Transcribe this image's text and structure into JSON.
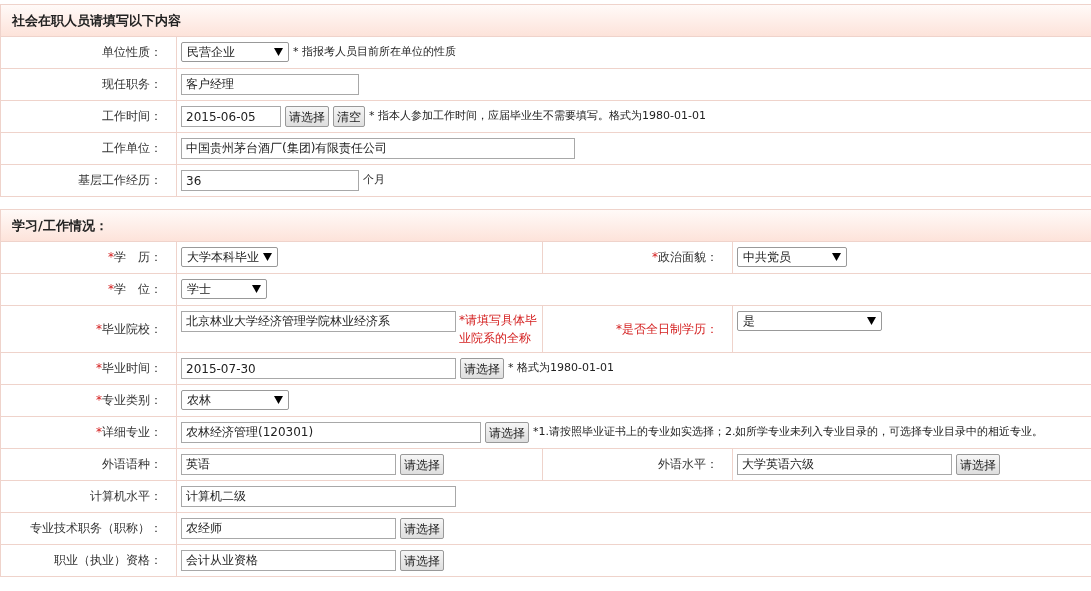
{
  "sections": [
    {
      "title": "社会在职人员请填写以下内容",
      "rows": [
        {
          "cells": [
            {
              "label": "单位性质：",
              "controls": [
                {
                  "kind": "select",
                  "value": "民营企业"
                },
                {
                  "kind": "note",
                  "text": "* 指报考人员目前所在单位的性质"
                }
              ]
            }
          ]
        },
        {
          "cells": [
            {
              "label": "现任职务：",
              "controls": [
                {
                  "kind": "input",
                  "value": "客户经理"
                }
              ]
            }
          ]
        },
        {
          "cells": [
            {
              "label": "工作时间：",
              "controls": [
                {
                  "kind": "input",
                  "value": "2015-06-05"
                },
                {
                  "kind": "button",
                  "label": "请选择"
                },
                {
                  "kind": "button",
                  "label": "清空"
                },
                {
                  "kind": "note",
                  "text": "* 指本人参加工作时间，应届毕业生不需要填写。格式为1980-01-01"
                }
              ]
            }
          ]
        },
        {
          "cells": [
            {
              "label": "工作单位：",
              "controls": [
                {
                  "kind": "input",
                  "value": "中国贵州茅台酒厂(集团)有限责任公司"
                }
              ]
            }
          ]
        },
        {
          "cells": [
            {
              "label": "基层工作经历：",
              "controls": [
                {
                  "kind": "input",
                  "value": "36"
                },
                {
                  "kind": "note",
                  "text": "个月"
                }
              ]
            }
          ]
        }
      ]
    },
    {
      "title": "学习/工作情况：",
      "rows": [
        {
          "cells": [
            {
              "mark": "*",
              "label": "学　历：",
              "alert": false,
              "controls": [
                {
                  "kind": "select",
                  "value": "大学本科毕业"
                }
              ]
            },
            {
              "mark": "*",
              "label": "政治面貌：",
              "alert": false,
              "controls": [
                {
                  "kind": "select",
                  "value": "中共党员"
                }
              ]
            }
          ]
        },
        {
          "cells": [
            {
              "mark": "*",
              "label": "学　位：",
              "alert": false,
              "controls": [
                {
                  "kind": "select",
                  "value": "学士"
                }
              ]
            }
          ]
        },
        {
          "cells": [
            {
              "mark": "*",
              "label": "毕业院校：",
              "alert": false,
              "controls": [
                {
                  "kind": "input",
                  "value": "北京林业大学经济管理学院林业经济系"
                },
                {
                  "kind": "hint",
                  "text": "*请填写具体毕业院系的全称"
                }
              ]
            },
            {
              "mark": "*",
              "label": "是否全日制学历：",
              "alert": true,
              "controls": [
                {
                  "kind": "select",
                  "value": "是"
                }
              ]
            }
          ]
        },
        {
          "cells": [
            {
              "mark": "*",
              "label": "毕业时间：",
              "alert": false,
              "controls": [
                {
                  "kind": "input",
                  "value": "2015-07-30"
                },
                {
                  "kind": "button",
                  "label": "请选择"
                },
                {
                  "kind": "note",
                  "text": "* 格式为1980-01-01"
                }
              ]
            }
          ]
        },
        {
          "cells": [
            {
              "mark": "*",
              "label": "专业类别：",
              "alert": false,
              "controls": [
                {
                  "kind": "select",
                  "value": "农林"
                }
              ]
            }
          ]
        },
        {
          "cells": [
            {
              "mark": "*",
              "label": "详细专业：",
              "alert": false,
              "controls": [
                {
                  "kind": "input",
                  "value": "农林经济管理(120301)"
                },
                {
                  "kind": "button",
                  "label": "请选择"
                },
                {
                  "kind": "note",
                  "text": "*1.请按照毕业证书上的专业如实选择；2.如所学专业未列入专业目录的，可选择专业目录中的相近专业。"
                }
              ]
            }
          ]
        },
        {
          "cells": [
            {
              "label": "外语语种：",
              "controls": [
                {
                  "kind": "input",
                  "value": "英语"
                },
                {
                  "kind": "button",
                  "label": "请选择"
                }
              ]
            },
            {
              "label": "外语水平：",
              "controls": [
                {
                  "kind": "input",
                  "value": "大学英语六级"
                },
                {
                  "kind": "button",
                  "label": "请选择"
                }
              ]
            }
          ]
        },
        {
          "cells": [
            {
              "label": "计算机水平：",
              "controls": [
                {
                  "kind": "input",
                  "value": "计算机二级"
                }
              ]
            }
          ]
        },
        {
          "cells": [
            {
              "label": "专业技术职务（职称）：",
              "controls": [
                {
                  "kind": "input",
                  "value": "农经师"
                },
                {
                  "kind": "button",
                  "label": "请选择"
                }
              ]
            }
          ]
        },
        {
          "cells": [
            {
              "label": "职业（执业）资格：",
              "controls": [
                {
                  "kind": "input",
                  "value": "会计从业资格"
                },
                {
                  "kind": "button",
                  "label": "请选择"
                }
              ]
            }
          ]
        }
      ]
    }
  ]
}
